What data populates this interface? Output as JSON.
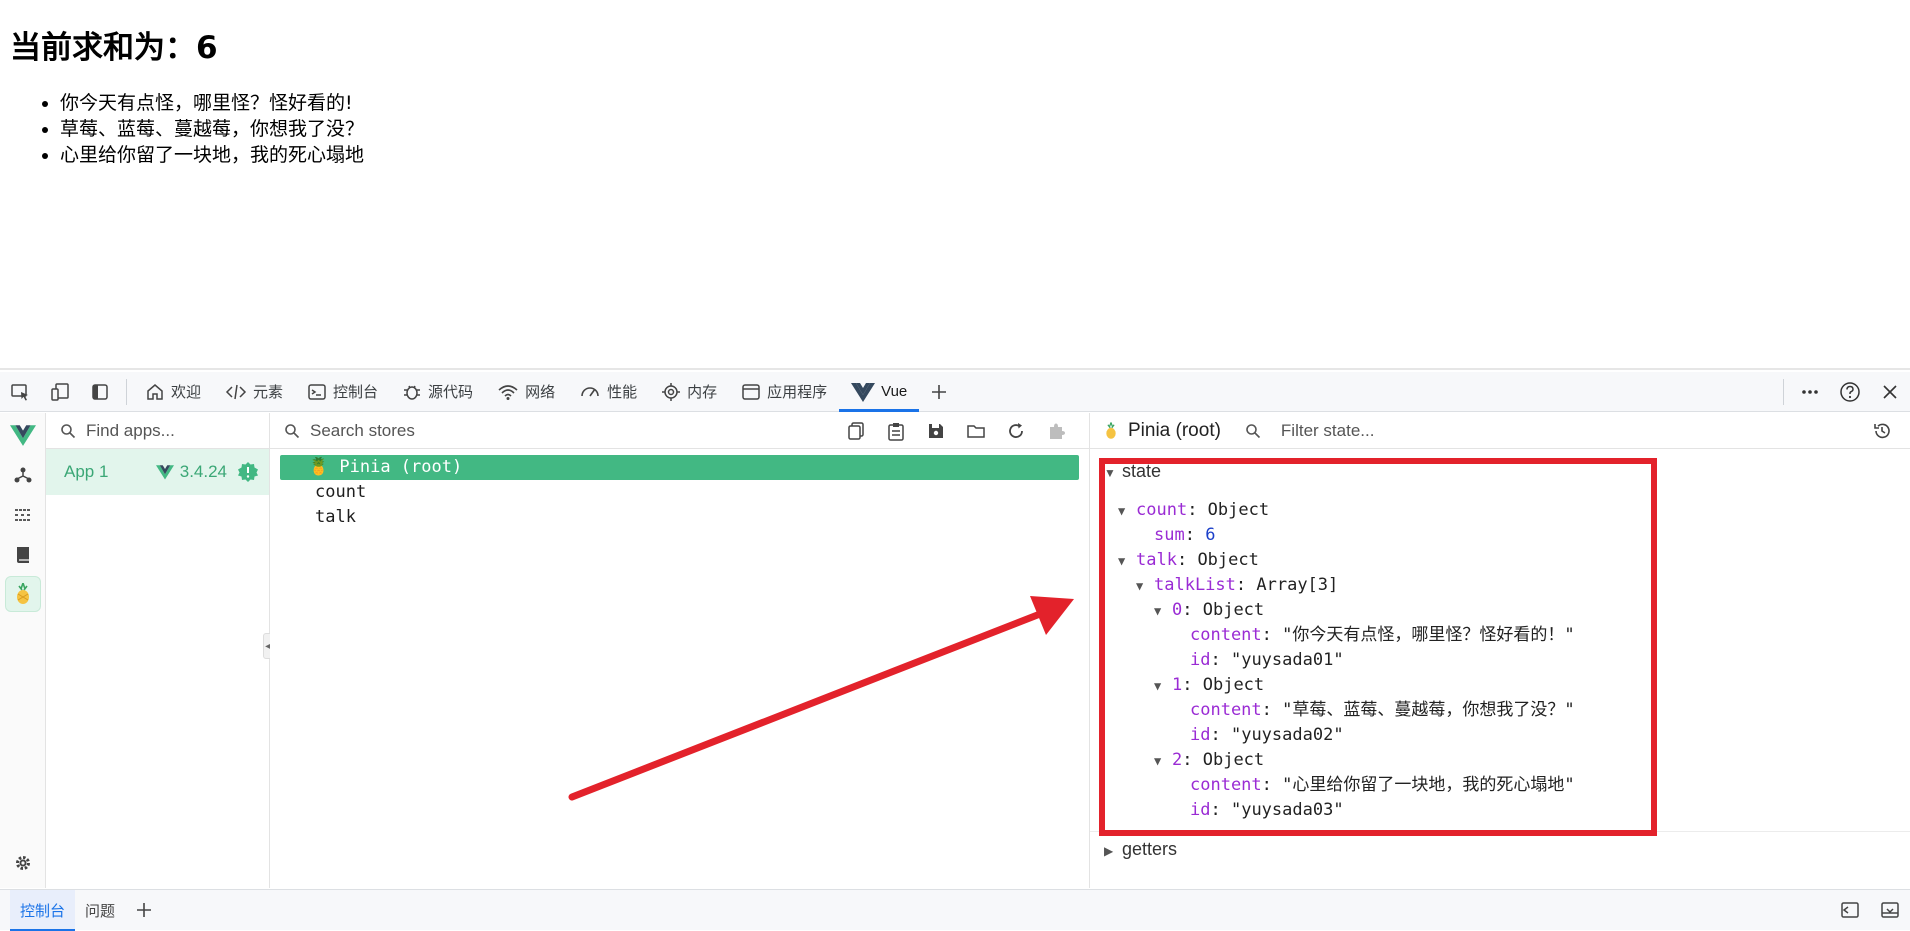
{
  "page": {
    "heading": "当前求和为：6",
    "talk_items": [
      "你今天有点怪，哪里怪？怪好看的!",
      "草莓、蓝莓、蔓越莓，你想我了没？",
      "心里给你留了一块地，我的死心塌地"
    ]
  },
  "devtools": {
    "tabs": [
      {
        "label": "欢迎",
        "icon": "home-icon"
      },
      {
        "label": "元素",
        "icon": "code-icon"
      },
      {
        "label": "控制台",
        "icon": "console-icon"
      },
      {
        "label": "源代码",
        "icon": "bug-icon"
      },
      {
        "label": "网络",
        "icon": "wifi-icon"
      },
      {
        "label": "性能",
        "icon": "gauge-icon"
      },
      {
        "label": "内存",
        "icon": "chip-icon"
      },
      {
        "label": "应用程序",
        "icon": "window-icon"
      },
      {
        "label": "Vue",
        "icon": "vue-logo-icon"
      }
    ],
    "active_tab": "Vue",
    "drawer": {
      "tabs": [
        "控制台",
        "问题"
      ],
      "active": "控制台"
    }
  },
  "apps": {
    "search_placeholder": "Find apps...",
    "app_name": "App 1",
    "vue_version": "3.4.24"
  },
  "stores": {
    "search_placeholder": "Search stores",
    "items": [
      "🍍 Pinia (root)",
      "count",
      "talk"
    ],
    "selected": "🍍 Pinia (root)"
  },
  "inspector": {
    "title": "Pinia (root)",
    "filter_placeholder": "Filter state...",
    "state_label": "state",
    "getters_label": "getters",
    "count_key": "count",
    "count_type": "Object",
    "sum_key": "sum",
    "sum_value": "6",
    "talk_key": "talk",
    "talk_type": "Object",
    "talklist_key": "talkList",
    "talklist_type": "Array[3]",
    "entries": [
      {
        "index": "0",
        "type": "Object",
        "content": "\"你今天有点怪，哪里怪？怪好看的！\"",
        "id": "\"yuysada01\""
      },
      {
        "index": "1",
        "type": "Object",
        "content": "\"草莓、蓝莓、蔓越莓，你想我了没？\"",
        "id": "\"yuysada02\""
      },
      {
        "index": "2",
        "type": "Object",
        "content": "\"心里给你留了一块地，我的死心塌地\"",
        "id": "\"yuysada03\""
      }
    ],
    "content_key": "content",
    "id_key": "id"
  },
  "colors": {
    "vue_green": "#42b883",
    "annotation_red": "#e3222b",
    "key_purple": "#9a2bd4",
    "tab_blue": "#1a73e8"
  }
}
